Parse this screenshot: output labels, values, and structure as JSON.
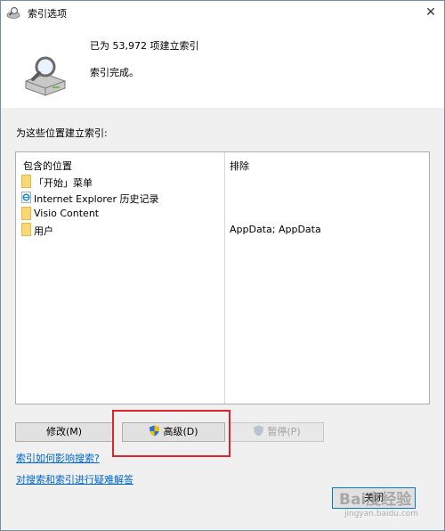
{
  "window": {
    "title": "索引选项",
    "close_glyph": "✕"
  },
  "status": {
    "count_text": "已为 53,972 项建立索引",
    "state_text": "索引完成。"
  },
  "locations_label": "为这些位置建立索引:",
  "table": {
    "col_included": "包含的位置",
    "col_excluded": "排除",
    "rows": [
      {
        "location": "「开始」菜单",
        "exclude": "",
        "icon": "folder-icon"
      },
      {
        "location": "Internet Explorer 历史记录",
        "exclude": "",
        "icon": "ie-icon"
      },
      {
        "location": "Visio Content",
        "exclude": "",
        "icon": "folder-icon"
      },
      {
        "location": "用户",
        "exclude": "AppData; AppData",
        "icon": "folder-icon"
      }
    ]
  },
  "buttons": {
    "modify": "修改(M)",
    "advanced": "高级(D)",
    "pause": "暂停(P)",
    "close": "关闭"
  },
  "links": {
    "how_affects": "索引如何影响搜索?",
    "troubleshoot": "对搜索和索引进行疑难解答"
  },
  "watermark": {
    "main": "Bai度经验",
    "sub": "jingyan.baidu.com"
  },
  "colors": {
    "link": "#0066cc",
    "highlight": "#e0242b",
    "folder": "#f8d775"
  }
}
